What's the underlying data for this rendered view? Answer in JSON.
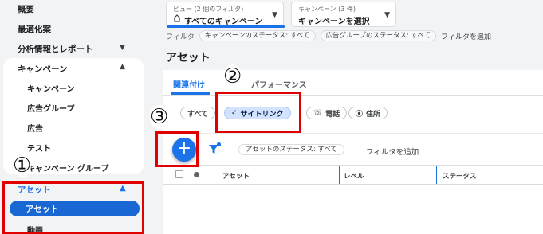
{
  "sidebar": {
    "overview": "概要",
    "recommendations": "最適化案",
    "insights_reports": "分析情報とレポート",
    "campaigns_header": "キャンペーン",
    "campaigns_subitems": [
      "キャンペーン",
      "広告グループ",
      "広告",
      "テスト",
      "キャンペーン グループ"
    ],
    "assets_header": "アセット",
    "assets_active": "アセット",
    "video": "動画"
  },
  "header": {
    "view_small": "ビュー (2 個のフィルタ)",
    "view_value": "すべてのキャンペーン",
    "campaign_small": "キャンペーン (3 件)",
    "campaign_value": "キャンペーンを選択",
    "filter_label": "フィルタ",
    "filter_chips": [
      "キャンペーンのステータス: すべて",
      "広告グループのステータス: すべて"
    ],
    "filter_add": "フィルタを追加"
  },
  "page": {
    "title": "アセット",
    "tabs": [
      "関連付け",
      "パフォーマンス"
    ],
    "asset_types": [
      {
        "label": "すべて",
        "icon": ""
      },
      {
        "label": "サイトリンク",
        "icon": "check-icon",
        "selected": true
      },
      {
        "label": "電話",
        "icon": "phone-icon"
      },
      {
        "label": "住所",
        "icon": "location-pin-icon"
      }
    ],
    "add_button_glyph": "+",
    "status_chip": "アセットのステータス: すべて",
    "add_filter": "フィルタを追加",
    "table_headers": [
      "アセット",
      "レベル",
      "ステータス"
    ]
  },
  "annotations": [
    "①",
    "②",
    "③"
  ],
  "colors": {
    "accent": "#1a73e8",
    "active_nav": "#1967d2",
    "annotation_red": "#e00000",
    "chip_selected": "#d3e3fd"
  }
}
